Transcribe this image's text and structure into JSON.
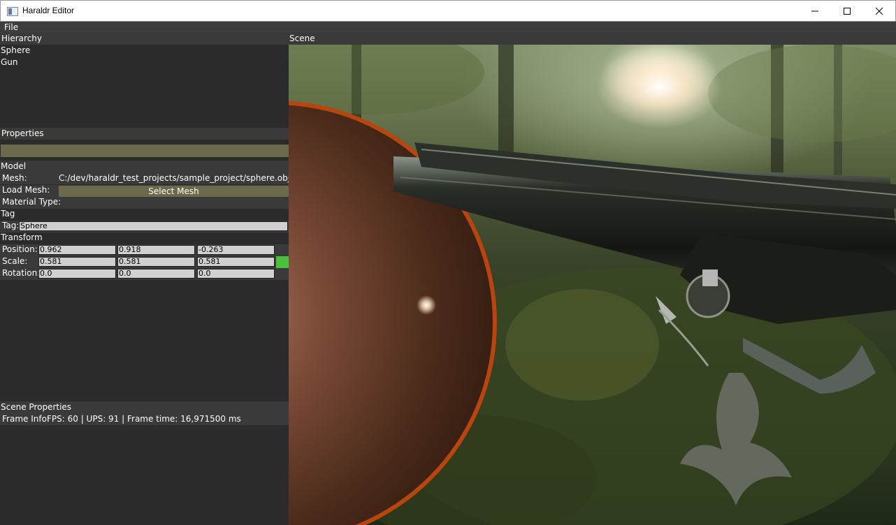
{
  "window": {
    "title": "Haraldr Editor"
  },
  "menu": {
    "file": "File"
  },
  "hierarchy": {
    "header": "Hierarchy",
    "items": [
      "Sphere",
      "Gun"
    ]
  },
  "properties": {
    "header": "Properties",
    "model": {
      "header": "Model",
      "mesh_label": "Mesh:",
      "mesh_value": "C:/dev/haraldr_test_projects/sample_project/sphere.obj",
      "load_mesh_label": "Load Mesh:",
      "select_mesh_button": "Select Mesh",
      "material_type_label": "Material Type:"
    },
    "tag": {
      "header": "Tag",
      "label": "Tag:",
      "value": "Sphere"
    },
    "transform": {
      "header": "Transform",
      "position_label": "Position:",
      "position": [
        "0.962",
        "0.918",
        "-0.263"
      ],
      "scale_label": "Scale:",
      "scale": [
        "0.581",
        "0.581",
        "0.581"
      ],
      "rotation_label": "Rotation:",
      "rotation": [
        "0.0",
        "0.0",
        "0.0"
      ]
    }
  },
  "scene_properties": {
    "header": "Scene Properties",
    "frame_info_label": "Frame Info:",
    "frame_info_value": "FPS: 60 | UPS: 91 | Frame time: 16,971500 ms"
  },
  "scene": {
    "header": "Scene"
  },
  "colors": {
    "accent_olive": "#6c6a4c",
    "scale_lock": "#46c33a",
    "sphere_rim": "#b8440e"
  }
}
